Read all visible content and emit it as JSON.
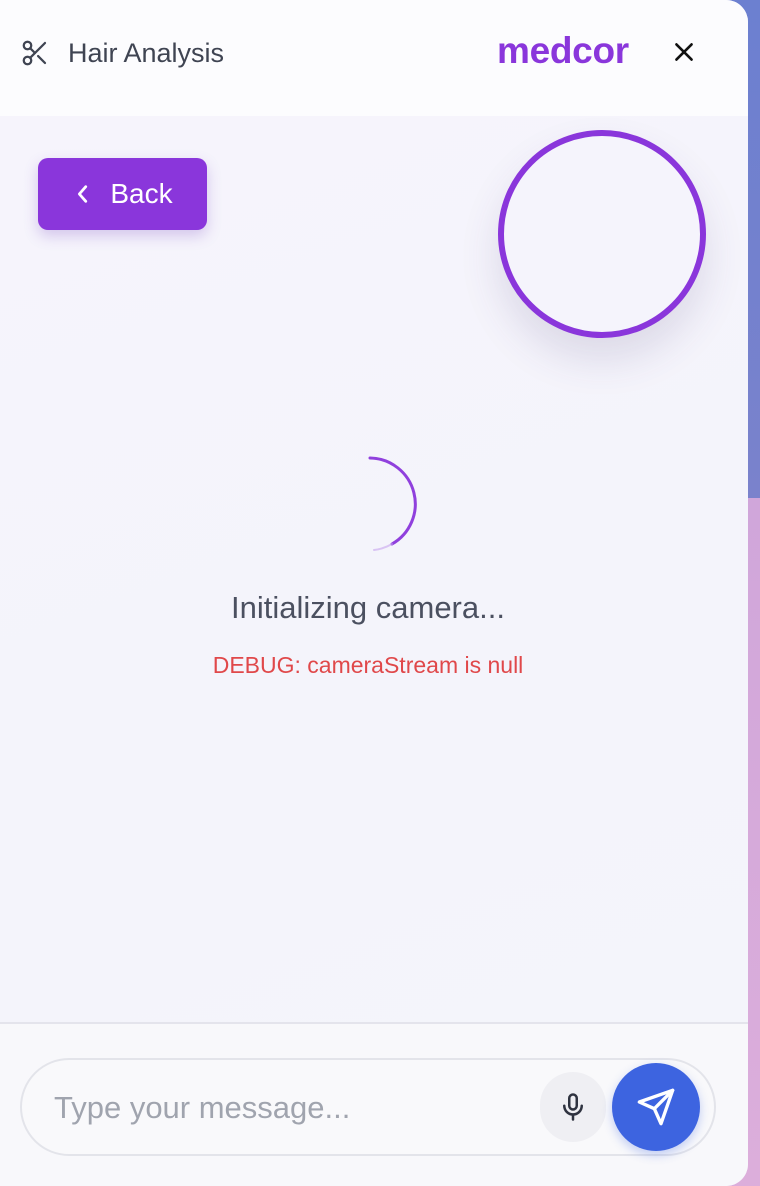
{
  "header": {
    "title": "Hair Analysis",
    "title_icon": "scissors-icon",
    "brand": "medcor",
    "close_icon": "close-icon"
  },
  "content": {
    "back_label": "Back",
    "back_icon": "chevron-left-icon",
    "status_text": "Initializing camera...",
    "debug_text": "DEBUG: cameraStream is null"
  },
  "footer": {
    "input_placeholder": "Type your message...",
    "input_value": "",
    "mic_icon": "microphone-icon",
    "send_icon": "send-icon"
  },
  "colors": {
    "accent": "#8a36db",
    "send": "#3d64e0",
    "debug": "#e0484a"
  }
}
